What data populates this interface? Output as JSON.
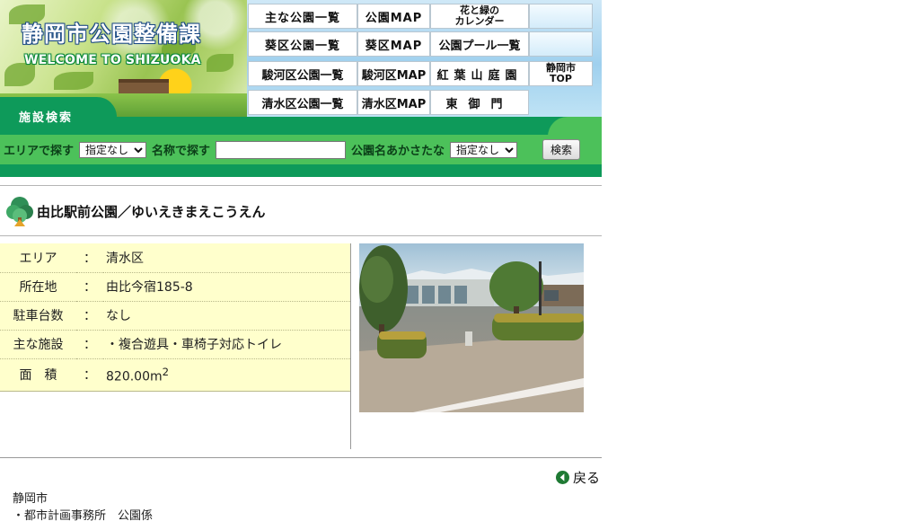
{
  "header": {
    "site_title": "静岡市公園整備課",
    "site_subtitle": "WELCOME TO SHIZUOKA",
    "nav": [
      {
        "label": "主な公園一覧"
      },
      {
        "label": "公園MAP"
      },
      {
        "label_line1": "花と緑の",
        "label_line2": "カレンダー"
      },
      {
        "label": "葵区公園一覧"
      },
      {
        "label": "葵区MAP"
      },
      {
        "label": "公園プール一覧"
      },
      {
        "label": "駿河区公園一覧"
      },
      {
        "label": "駿河区MAP"
      },
      {
        "label": "紅葉山庭園"
      },
      {
        "label_line1": "静岡市",
        "label_line2": "TOP"
      },
      {
        "label": "清水区公園一覧"
      },
      {
        "label": "清水区MAP"
      },
      {
        "label": "東御門"
      }
    ]
  },
  "search": {
    "tab_label": "施設検索",
    "area_label": "エリアで探す",
    "area_value": "指定なし",
    "name_label": "名称で探す",
    "name_value": "",
    "kana_label": "公園名あかさたな",
    "kana_value": "指定なし",
    "submit_label": "検索"
  },
  "park": {
    "title": "由比駅前公園／ゆいえきまえこうえん",
    "rows": [
      {
        "label": "エリア",
        "colon": "：",
        "value": "清水区"
      },
      {
        "label": "所在地",
        "colon": "：",
        "value": "由比今宿185-8"
      },
      {
        "label": "駐車台数",
        "colon": "：",
        "value": "なし"
      },
      {
        "label": "主な施設",
        "colon": "：",
        "value": "・複合遊具・車椅子対応トイレ"
      },
      {
        "label": "面　積",
        "colon": "：",
        "value": "820.00m",
        "sup": "2"
      }
    ]
  },
  "footer": {
    "back_label": "戻る",
    "org": "静岡市",
    "dept": "・都市計画事務所　公園係"
  },
  "colors": {
    "band_dark": "#0e9a5a",
    "band_light": "#4cc15a",
    "table_bg": "#ffffcc"
  }
}
